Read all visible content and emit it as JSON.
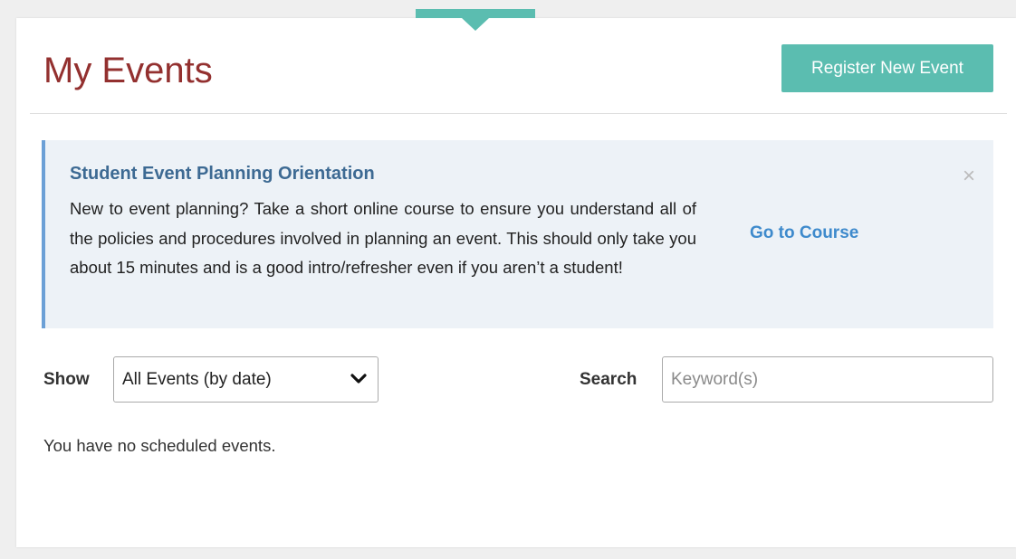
{
  "header": {
    "title": "My Events",
    "register_label": "Register New Event"
  },
  "alert": {
    "title": "Student Event Planning Orientation",
    "body": "New to event planning? Take a short online course to ensure you understand all of the policies and procedures involved in planning an event. This should only take you about 15 minutes and is a good intro/refresher even if you aren’t a student!",
    "link_label": "Go to Course",
    "close_glyph": "×"
  },
  "filters": {
    "show_label": "Show",
    "show_selected": "All Events (by date)",
    "search_label": "Search",
    "search_placeholder": "Keyword(s)",
    "search_value": ""
  },
  "events": {
    "empty_message": "You have no scheduled events."
  },
  "colors": {
    "accent": "#5bbdb0",
    "title": "#93302f",
    "alert_bg": "#edf2f7",
    "alert_border": "#6ca0d6",
    "alert_title": "#3d6a93",
    "link": "#3e8acc"
  },
  "icons": {
    "select_chevron": "chevron-down-icon",
    "alert_close": "close-icon"
  }
}
